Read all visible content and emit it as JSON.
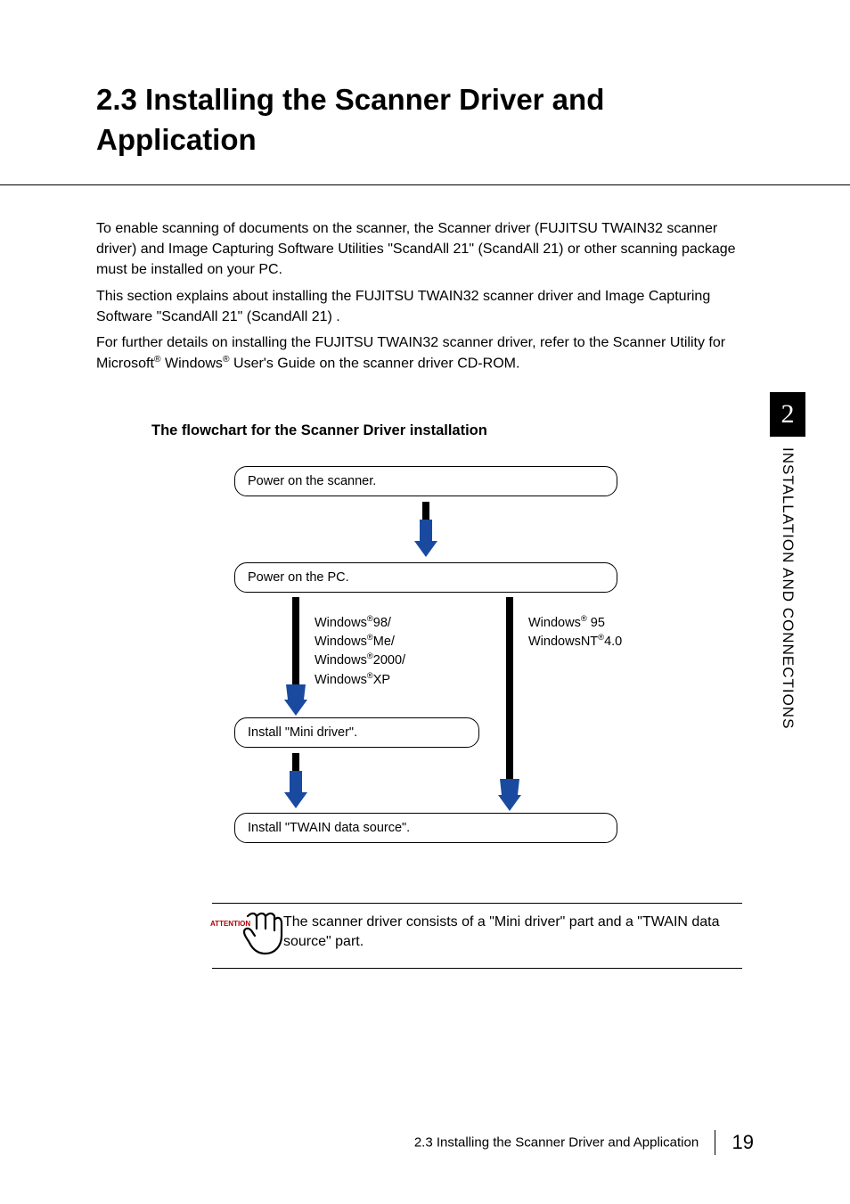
{
  "title": "2.3   Installing the Scanner Driver and Application",
  "paragraphs": {
    "p1": "To enable scanning of documents on the scanner, the Scanner driver (FUJITSU TWAIN32 scanner driver) and Image Capturing Software Utilities \"ScandAll 21\" (ScandAll 21) or other scanning package must be installed on your PC.",
    "p2": "This section explains about installing the FUJITSU TWAIN32 scanner driver and Image Capturing Software \"ScandAll 21\" (ScandAll 21) .",
    "p3a": "For further details on installing the FUJITSU TWAIN32 scanner driver, refer to the Scanner Utility for Microsoft",
    "p3b": " Windows",
    "p3c": " User's Guide on the scanner driver CD-ROM."
  },
  "flowchart_title": "The flowchart for the Scanner Driver installation",
  "flowchart": {
    "step1": "Power on the scanner.",
    "step2": "Power on the PC.",
    "os_left": {
      "l1a": "Windows",
      "l1b": "98/",
      "l2a": "Windows",
      "l2b": "Me/",
      "l3a": "Windows",
      "l3b": "2000/",
      "l4a": "Windows",
      "l4b": "XP"
    },
    "os_right": {
      "l1a": "Windows",
      "l1b": "95",
      "l2a": "WindowsNT",
      "l2b": "4.0"
    },
    "step3": "Install \"Mini driver\".",
    "step4": "Install \"TWAIN data source\"."
  },
  "attention": {
    "label": "ATTENTION",
    "text": "The scanner driver consists of a \"Mini driver\" part and a \"TWAIN data source\" part."
  },
  "sidetab": {
    "chapter": "2",
    "title": "INSTALLATION AND CONNECTIONS"
  },
  "footer": {
    "text": "2.3 Installing the Scanner Driver and Application",
    "page": "19"
  },
  "reg": "®"
}
